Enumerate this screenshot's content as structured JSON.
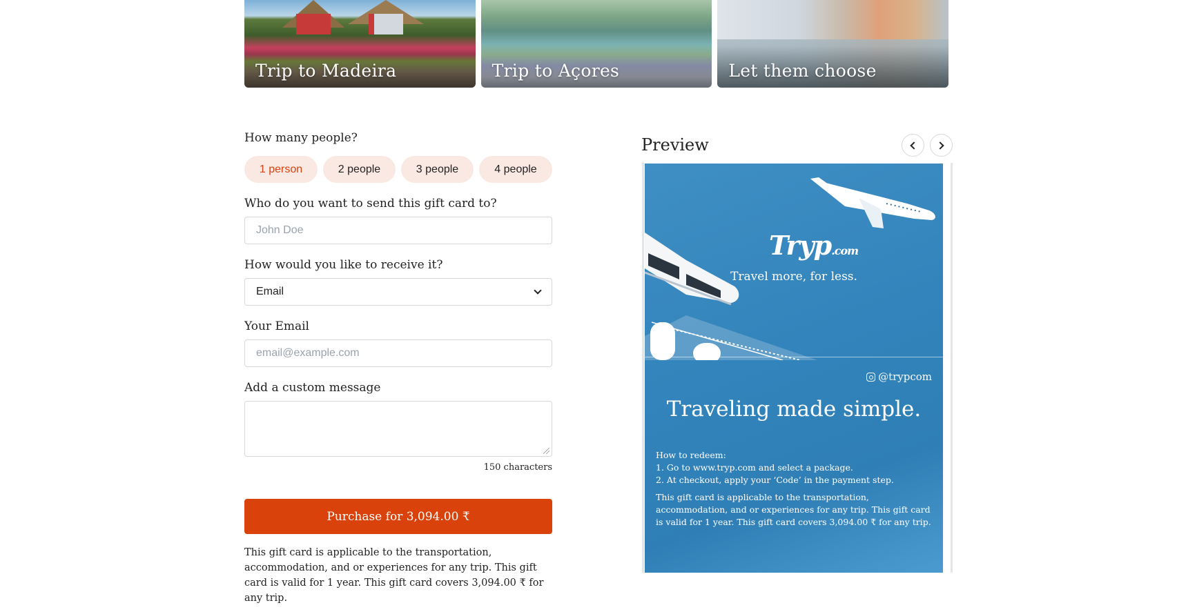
{
  "trips": [
    {
      "label": "Trip to Madeira"
    },
    {
      "label": "Trip to Açores"
    },
    {
      "label": "Let them choose"
    }
  ],
  "form": {
    "people_question": "How many people?",
    "people_options": [
      "1 person",
      "2 people",
      "3 people",
      "4 people"
    ],
    "selected_people": "1 person",
    "recipient_question": "Who do you want to send this gift card to?",
    "recipient_placeholder": "John Doe",
    "receive_question": "How would you like to receive it?",
    "receive_value": "Email",
    "email_label": "Your Email",
    "email_placeholder": "email@example.com",
    "message_label": "Add a custom message",
    "char_count": "150 characters",
    "purchase_label": "Purchase for 3,094.00 ₹",
    "note": "This gift card is applicable to the transportation, accommodation, and or experiences for any trip. This gift card is valid for 1 year. This gift card covers 3,094.00 ₹ for any trip."
  },
  "preview": {
    "title": "Preview",
    "card": {
      "logo": "Tryp",
      "logo_suffix": ".com",
      "tagline": "Travel more, for less.",
      "instagram": "@trypcom",
      "headline": "Traveling made simple.",
      "redeem_title": "How to redeem:",
      "step1": "1. Go to www.tryp.com and select a package.",
      "step2": "2. At checkout, apply your ‘Code’ in the payment step.",
      "terms": "This gift card is applicable to the transportation, accommodation, and or experiences for any trip. This gift card is valid for 1 year. This gift card covers 3,094.00 ₹ for any trip."
    }
  },
  "colors": {
    "accent": "#d9420b",
    "pill_bg": "#fae9e3",
    "card_blue": "#3384bc"
  },
  "icons": [
    "chevron-down-icon",
    "chevron-left-icon",
    "chevron-right-icon",
    "instagram-icon",
    "plane-illustration",
    "train-illustration"
  ]
}
